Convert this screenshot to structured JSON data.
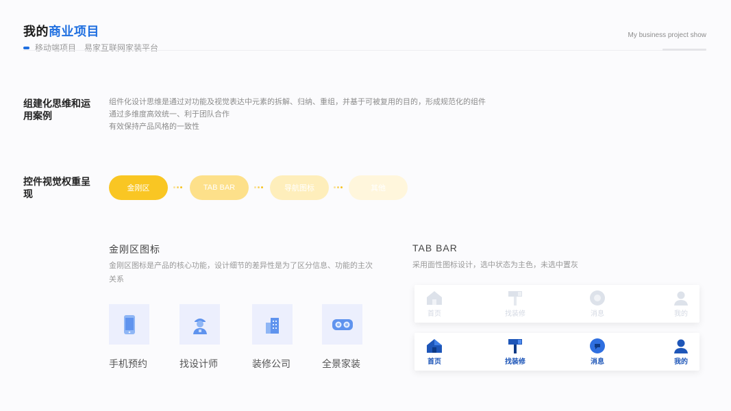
{
  "header": {
    "title_prefix": "我的",
    "title_highlight": "商业项目",
    "subtitle_1": "移动端项目",
    "subtitle_2": "易家互联网家装平台",
    "en_title": "My business project show"
  },
  "section_components": {
    "title": "组建化思维和运用案例",
    "desc_lines": [
      "组件化设计思维是通过对功能及视觉表达中元素的拆解、归纳、重组，并基于可被复用的目的，形成规范化的组件",
      "通过多维度高效统一、利于团队合作",
      "有效保持产品风格的一致性"
    ]
  },
  "section_weight": {
    "title": "控件视觉权重呈现",
    "pills": [
      "金刚区",
      "TAB BAR",
      "导航图标",
      "其他"
    ]
  },
  "jingang": {
    "title": "金刚区图标",
    "desc": "金刚区图标是产品的核心功能，设计细节的差异性是为了区分信息、功能的主次关系",
    "items": [
      {
        "label": "手机预约",
        "icon": "phone-icon"
      },
      {
        "label": "找设计师",
        "icon": "designer-icon"
      },
      {
        "label": "装修公司",
        "icon": "building-icon"
      },
      {
        "label": "全景家装",
        "icon": "vr-glasses-icon"
      }
    ]
  },
  "tabbar": {
    "title": "TAB BAR",
    "desc": "采用面性图标设计，选中状态为主色，未选中置灰",
    "items": [
      {
        "label": "首页",
        "icon": "home-icon"
      },
      {
        "label": "找装修",
        "icon": "paint-roller-icon"
      },
      {
        "label": "消息",
        "icon": "message-icon"
      },
      {
        "label": "我的",
        "icon": "user-icon"
      }
    ],
    "inactive_color": "#d4d9e3",
    "active_color": "#1e56b8"
  },
  "colors": {
    "accent": "#1f6fe0",
    "pill_1": "#f9c623",
    "pill_2": "#fde08a",
    "pill_3": "#feeebb",
    "pill_4": "#fff6dc",
    "tile_bg": "#eceffd"
  }
}
